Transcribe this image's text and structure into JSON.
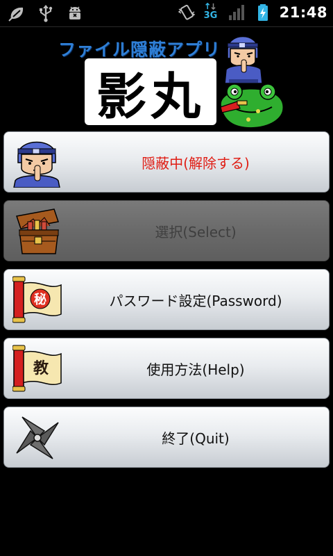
{
  "status_bar": {
    "time": "21:48",
    "network": "3G",
    "icons": [
      "leaf-notification-icon",
      "usb-icon",
      "android-debug-icon",
      "vibrate-icon",
      "data-activity-icon",
      "signal-icon",
      "battery-charging-icon"
    ]
  },
  "banner": {
    "subtitle": "ファイル隠蔽アプリ",
    "title": "影丸"
  },
  "menu": {
    "items": [
      {
        "label": "隠蔽中(解除する)",
        "icon": "ninja-icon",
        "state": "active"
      },
      {
        "label": "選択(Select)",
        "icon": "treasure-chest-icon",
        "state": "disabled"
      },
      {
        "label": "パスワード設定(Password)",
        "icon": "secret-scroll-icon",
        "state": "normal"
      },
      {
        "label": "使用方法(Help)",
        "icon": "teaching-scroll-icon",
        "state": "normal"
      },
      {
        "label": "終了(Quit)",
        "icon": "shuriken-icon",
        "state": "normal"
      }
    ]
  },
  "colors": {
    "active_text": "#e01d14",
    "subtitle_blue": "#2f7fd6",
    "battery_teal": "#33b5e5"
  }
}
